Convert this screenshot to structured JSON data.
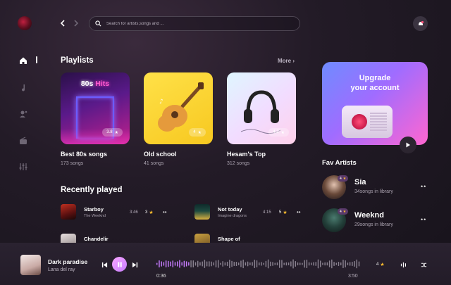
{
  "search": {
    "placeholder": "Search for artists,songs and ..."
  },
  "playlists": {
    "heading": "Playlists",
    "more_label": "More",
    "cards": [
      {
        "title": "Best 80s songs",
        "songs": "173 songs",
        "rating": "3.8",
        "art_text_1": "80s",
        "art_text_2": "Hits"
      },
      {
        "title": "Old school",
        "songs": "41 songs",
        "rating": "4"
      },
      {
        "title": "Hesam's Top",
        "songs": "312 songs",
        "rating": "4.2"
      }
    ]
  },
  "upgrade": {
    "line1": "Upgrade",
    "line2": "your account"
  },
  "fav_artists": {
    "heading": "Fav Artists",
    "items": [
      {
        "name": "Sia",
        "sub": "34songs in library",
        "badge": "4"
      },
      {
        "name": "Weeknd",
        "sub": "29songs in library",
        "badge": "4"
      }
    ]
  },
  "recently_played": {
    "heading": "Recently played",
    "items": [
      {
        "title": "Starboy",
        "artist": "The Weeknd",
        "duration": "3:46",
        "rating": "3"
      },
      {
        "title": "Not today",
        "artist": "Imagine dragons",
        "duration": "4:15",
        "rating": "5"
      },
      {
        "title": "Chandelir",
        "artist": "",
        "duration": "",
        "rating": ""
      },
      {
        "title": "Shape of",
        "artist": "",
        "duration": "",
        "rating": ""
      }
    ]
  },
  "player": {
    "title": "Dark paradise",
    "artist": "Lana del ray",
    "current_time": "0:36",
    "total_time": "3:50",
    "rating": "4",
    "progress": 0.16
  },
  "colors": {
    "accent": "#c77cff",
    "star": "#ffbf2e",
    "background": "#1c1620"
  },
  "icons": {
    "nav": [
      "home-icon",
      "music-note-icon",
      "artist-icon",
      "radio-icon",
      "equalizer-icon"
    ]
  }
}
